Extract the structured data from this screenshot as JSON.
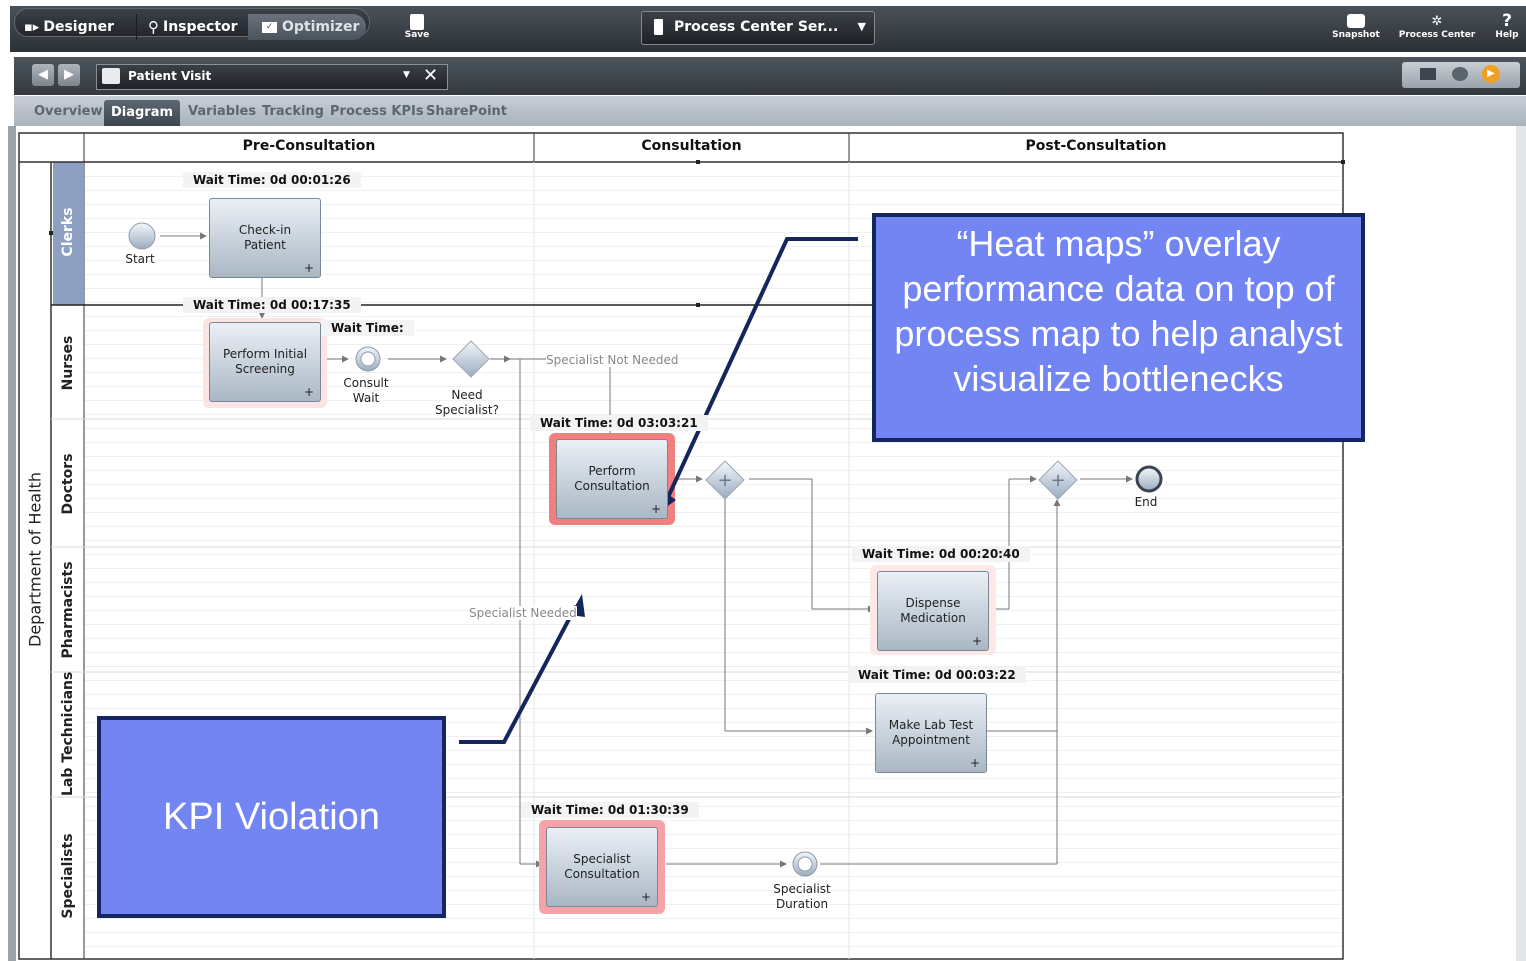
{
  "toolbar": {
    "designer": "Designer",
    "inspector": "Inspector",
    "optimizer": "Optimizer",
    "save": "Save",
    "server": "Process Center Ser...",
    "snapshot": "Snapshot",
    "process_center": "Process Center",
    "help": "Help"
  },
  "process": {
    "name": "Patient Visit"
  },
  "tabs": [
    "Overview",
    "Diagram",
    "Variables",
    "Tracking",
    "Process KPIs",
    "SharePoint"
  ],
  "pool": {
    "label": "Department of Health"
  },
  "phases": [
    "Pre-Consultation",
    "Consultation",
    "Post-Consultation"
  ],
  "lanes": [
    "Clerks",
    "Nurses",
    "Doctors",
    "Pharmacists",
    "Lab Technicians",
    "Specialists"
  ],
  "tasks": {
    "checkin": "Check-in Patient",
    "screening": "Perform Initial Screening",
    "consultation": "Perform Consultation",
    "dispense": "Dispense Medication",
    "labtest": "Make Lab Test Appointment",
    "specialist": "Specialist Consultation"
  },
  "wait_times": {
    "checkin": "Wait Time: 0d 00:01:26",
    "screening": "Wait Time: 0d 00:17:35",
    "screening_side": "Wait Time:",
    "consultation": "Wait Time: 0d 03:03:21",
    "dispense": "Wait Time: 0d 00:20:40",
    "labtest": "Wait Time: 0d 00:03:22",
    "specialist": "Wait Time: 0d 01:30:39"
  },
  "events": {
    "start": "Start",
    "end": "End",
    "consult_wait": "Consult Wait",
    "need_specialist": "Need Specialist?",
    "specialist_duration": "Specialist Duration"
  },
  "flows": {
    "not_needed": "Specialist Not Needed",
    "needed": "Specialist Needed"
  },
  "callouts": {
    "heatmap": "“Heat maps” overlay performance data on top of process map to help analyst visualize bottlenecks",
    "kpi": "KPI Violation"
  }
}
